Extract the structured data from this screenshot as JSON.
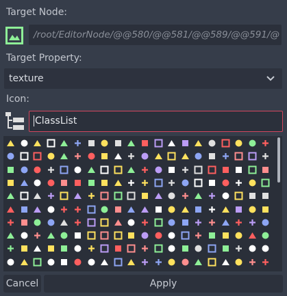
{
  "target_node": {
    "label": "Target Node:",
    "path": "/root/EditorNode/@@580/@@581/@@589/@@591/@",
    "icon": "texture-rect-icon"
  },
  "target_property": {
    "label": "Target Property:",
    "value": "texture"
  },
  "icon": {
    "label": "Icon:",
    "value": "ClassList",
    "list_icon": "class-list-icon"
  },
  "icon_grid": {
    "icon": "editor-icon",
    "colors": [
      "#ffffff",
      "#ff5f5f",
      "#8da5f3",
      "#ffe15e",
      "#8eef97",
      "#e0e0e0",
      "#fe8e8e",
      "#bb9cf5"
    ]
  },
  "buttons": {
    "cancel": "Cancel",
    "apply": "Apply"
  }
}
